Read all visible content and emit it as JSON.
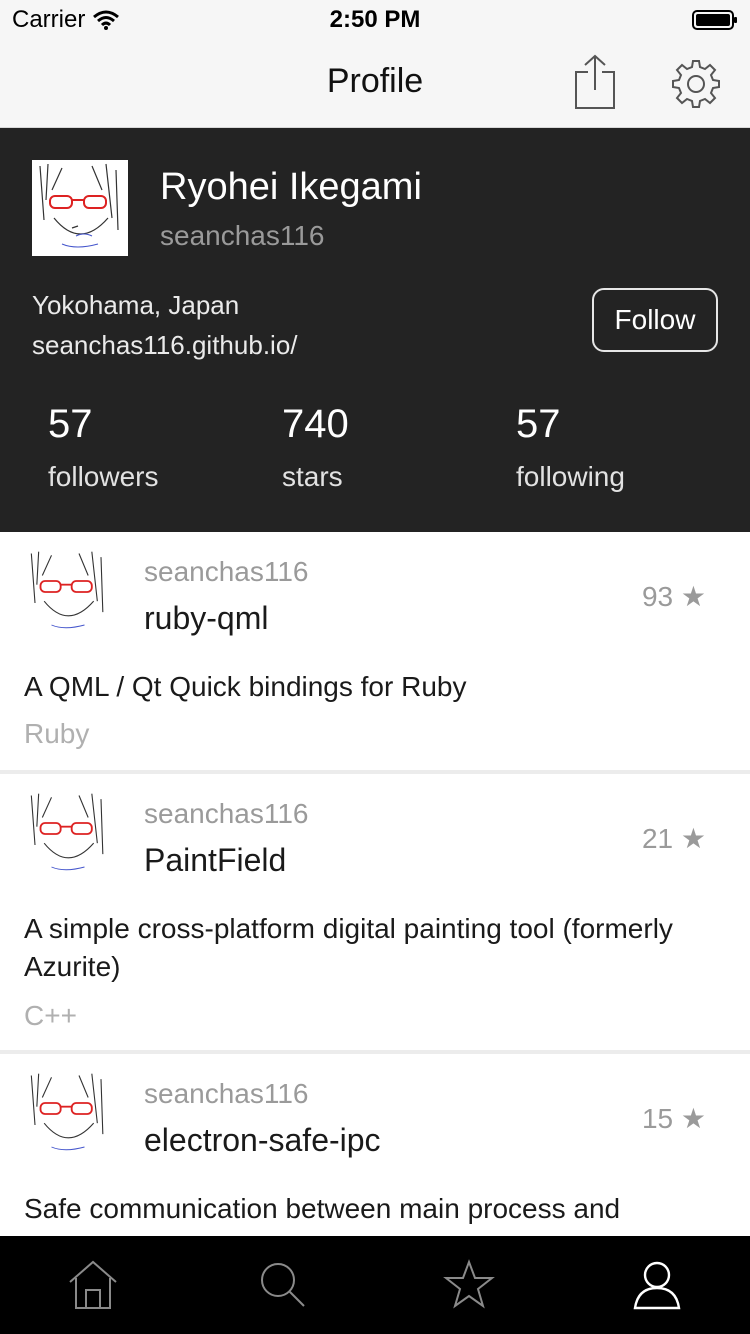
{
  "status": {
    "carrier": "Carrier",
    "time": "2:50 PM"
  },
  "nav": {
    "title": "Profile",
    "share_icon": "share-icon",
    "settings_icon": "gear-icon"
  },
  "profile": {
    "name": "Ryohei Ikegami",
    "login": "seanchas116",
    "location": "Yokohama, Japan",
    "blog": "seanchas116.github.io/",
    "follow_label": "Follow",
    "stats": [
      {
        "value": "57",
        "label": "followers"
      },
      {
        "value": "740",
        "label": "stars"
      },
      {
        "value": "57",
        "label": "following"
      }
    ]
  },
  "repos": [
    {
      "owner": "seanchas116",
      "name": "ruby-qml",
      "stars": "93 ★",
      "description": "A QML / Qt Quick bindings for Ruby",
      "language": "Ruby"
    },
    {
      "owner": "seanchas116",
      "name": "PaintField",
      "stars": "21 ★",
      "description": "A simple cross-platform digital painting tool (formerly Azurite)",
      "language": "C++"
    },
    {
      "owner": "seanchas116",
      "name": "electron-safe-ipc",
      "stars": "15 ★",
      "description": "Safe communication between main process and",
      "language": ""
    }
  ],
  "tabs": [
    {
      "icon": "home-icon"
    },
    {
      "icon": "search-icon"
    },
    {
      "icon": "star-icon"
    },
    {
      "icon": "person-icon"
    }
  ],
  "colors": {
    "header_bg": "#232323",
    "nav_bg": "#f6f6f6",
    "tabbar_bg": "#000000",
    "secondary_text": "#9a9a9a"
  }
}
